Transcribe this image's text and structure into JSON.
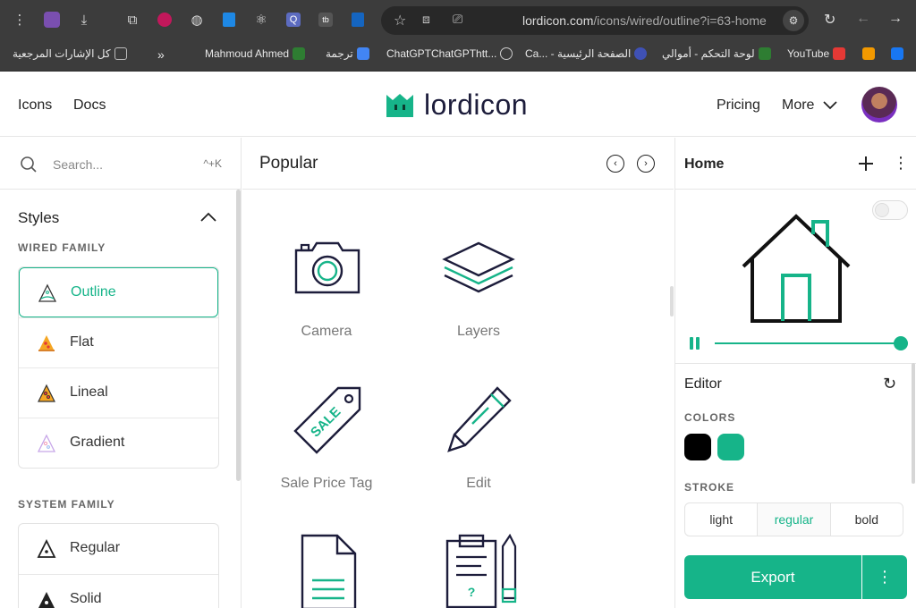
{
  "browser": {
    "url_host": "lordicon.com",
    "url_path": "/icons/wired/outline?i=63-home",
    "bookmarks": [
      {
        "label": "كل الإشارات المرجعية",
        "color": "#777"
      },
      {
        "label": "Mahmoud Ahmed",
        "color": "#2e7d32"
      },
      {
        "label": "ترجمة",
        "color": "#4285f4"
      },
      {
        "label": "ChatGPTChatGPThtt...",
        "color": "#777"
      },
      {
        "label": "Ca... - الصفحة الرئيسية",
        "color": "#3f51b5"
      },
      {
        "label": "لوحة التحكم - أموالي",
        "color": "#2e7d32"
      },
      {
        "label": "YouTube",
        "color": "#e53935"
      },
      {
        "label": "",
        "color": "#f29900"
      },
      {
        "label": "",
        "color": "#1877f2"
      }
    ],
    "bookmarks_more": "»"
  },
  "header": {
    "nav_icons": "Icons",
    "nav_docs": "Docs",
    "logo_text": "lordicon",
    "nav_pricing": "Pricing",
    "nav_more": "More"
  },
  "sidebar": {
    "search_placeholder": "Search...",
    "search_shortcut": "^+K",
    "styles_title": "Styles",
    "wired_family": "WIRED FAMILY",
    "wired_items": [
      {
        "label": "Outline",
        "active": true
      },
      {
        "label": "Flat"
      },
      {
        "label": "Lineal"
      },
      {
        "label": "Gradient"
      }
    ],
    "system_family": "SYSTEM FAMILY",
    "system_items": [
      {
        "label": "Regular"
      },
      {
        "label": "Solid"
      }
    ]
  },
  "main": {
    "title": "Popular",
    "icons": [
      {
        "label": "Camera"
      },
      {
        "label": "Layers"
      },
      {
        "label": "Sale Price Tag"
      },
      {
        "label": "Edit"
      },
      {
        "label": ""
      },
      {
        "label": ""
      }
    ],
    "sale_text": "SALE"
  },
  "panel": {
    "title": "Home",
    "editor_title": "Editor",
    "colors_label": "COLORS",
    "colors": [
      "#000000",
      "#16b489"
    ],
    "stroke_label": "STROKE",
    "stroke_options": [
      "light",
      "regular",
      "bold"
    ],
    "stroke_selected": "regular",
    "export_label": "Export",
    "playback_progress": 1.0
  },
  "colors": {
    "accent": "#16b489",
    "ink": "#1d1d3b"
  }
}
